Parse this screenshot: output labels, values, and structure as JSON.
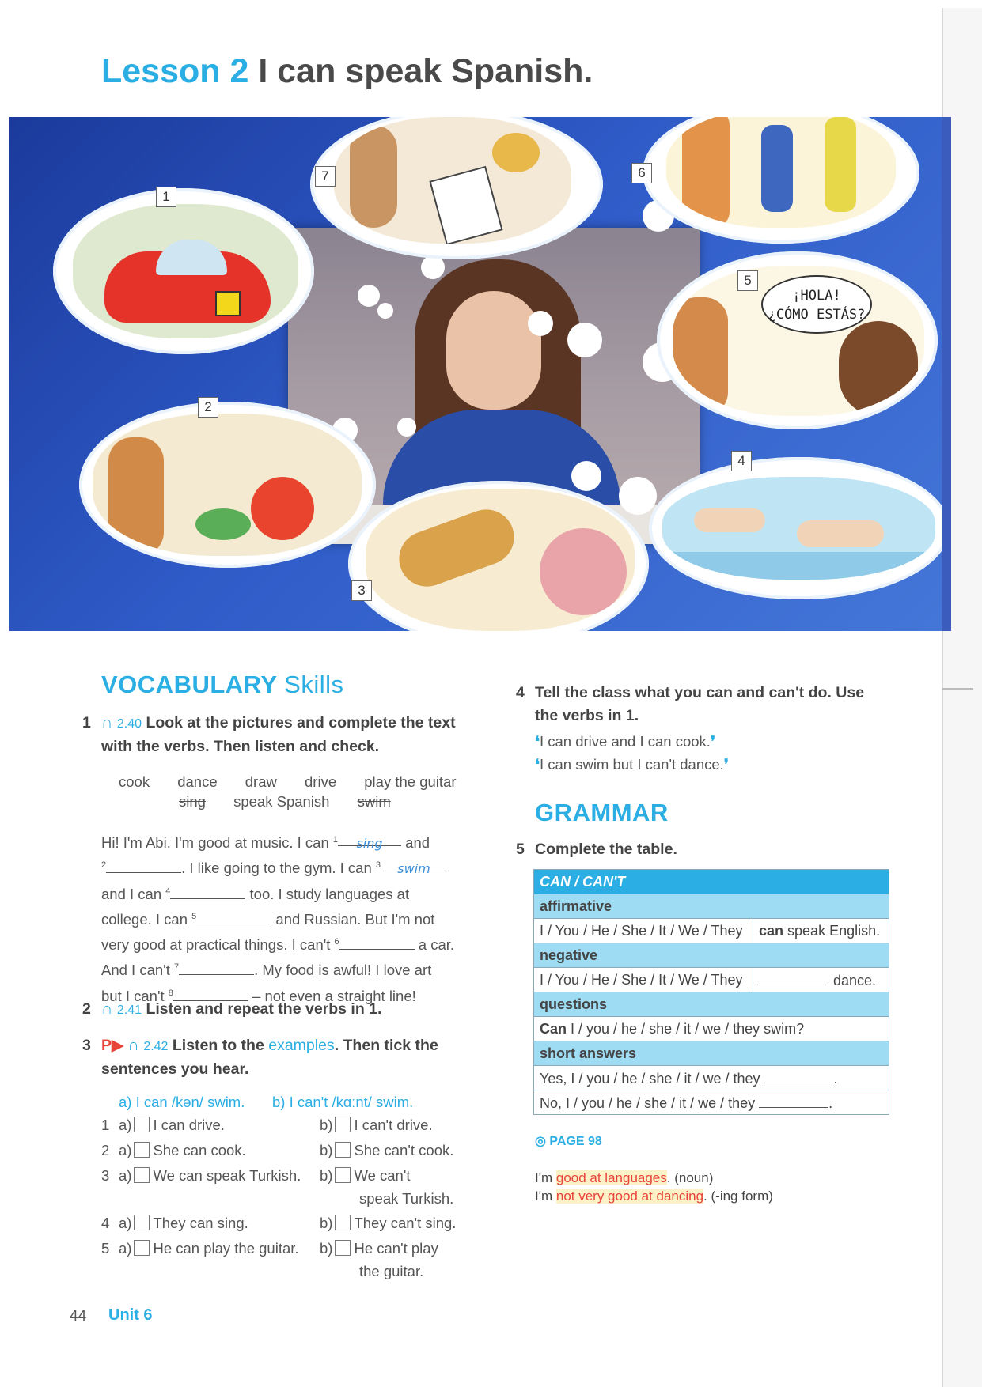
{
  "header": {
    "lesson_number": "Lesson 2",
    "lesson_title": "I can speak Spanish."
  },
  "illustration": {
    "picture_numbers": [
      "1",
      "2",
      "3",
      "4",
      "5",
      "6",
      "7"
    ],
    "speech_bubble_line1": "¡HOLA!",
    "speech_bubble_line2": "¿CÓMO ESTÁS?"
  },
  "vocabulary": {
    "heading_main": "VOCABULARY",
    "heading_sub": "Skills",
    "task1": {
      "number": "1",
      "track": "2.40",
      "instruction": "Look at the pictures and complete the text with the verbs. Then listen and check."
    },
    "word_box": {
      "row1": [
        "cook",
        "dance",
        "draw",
        "drive",
        "play the guitar"
      ],
      "row2": [
        "sing",
        "speak Spanish",
        "swim"
      ]
    },
    "text": {
      "l1a": "Hi! I'm Abi. I'm good at music. I can ",
      "n1": "1",
      "a1": "sing",
      "l1b": " and",
      "n2": "2",
      "l2a": ". I like going to the gym. I can ",
      "n3": "3",
      "a3": "swim",
      "l3a": "and I can ",
      "n4": "4",
      "l3b": " too. I study languages at",
      "l4a": "college. I can ",
      "n5": "5",
      "l4b": " and Russian. But I'm not",
      "l5a": "very good at practical things. I can't ",
      "n6": "6",
      "l5b": " a car.",
      "l6a": "And I can't ",
      "n7": "7",
      "l6b": ". My food is awful! I love art",
      "l7a": "but I can't ",
      "n8": "8",
      "l7b": " – not even a straight line!"
    },
    "task2": {
      "number": "2",
      "track": "2.41",
      "instruction": "Listen and repeat the verbs in 1."
    },
    "task3": {
      "number": "3",
      "track": "2.42",
      "instruction_a": "Listen to the ",
      "instruction_link": "examples",
      "instruction_b": ". Then tick the sentences you hear.",
      "examples": {
        "a": "a) I can /kən/ swim.",
        "b": "b)  I can't /kɑːnt/ swim."
      },
      "items": [
        {
          "n": "1",
          "a_label": "a)",
          "a": "I can drive.",
          "b_label": "b)",
          "b": "I can't drive.",
          "b2": ""
        },
        {
          "n": "2",
          "a_label": "a)",
          "a": "She can cook.",
          "b_label": "b)",
          "b": "She can't cook.",
          "b2": ""
        },
        {
          "n": "3",
          "a_label": "a)",
          "a": "We can speak Turkish.",
          "b_label": "b)",
          "b": "We can't",
          "b2": "speak Turkish."
        },
        {
          "n": "4",
          "a_label": "a)",
          "a": "They can sing.",
          "b_label": "b)",
          "b": "They can't sing.",
          "b2": ""
        },
        {
          "n": "5",
          "a_label": "a)",
          "a": "He can play the guitar.",
          "b_label": "b)",
          "b": "He can't play",
          "b2": "the guitar."
        }
      ]
    }
  },
  "task4": {
    "number": "4",
    "instruction": "Tell the class what you can and can't do. Use the verbs in 1.",
    "example1": "I can drive and I can cook.",
    "example2": "I can swim but I can't dance."
  },
  "grammar": {
    "heading": "GRAMMAR",
    "task5": {
      "number": "5",
      "instruction": "Complete the table."
    },
    "table": {
      "title": "CAN / CAN'T",
      "affirmative": "affirmative",
      "aff_subject": "I / You / He / She / It / We / They",
      "aff_verb_bold": "can",
      "aff_verb_rest": " speak English.",
      "negative": "negative",
      "neg_subject": "I / You / He / She / It / We / They",
      "neg_end": "dance.",
      "questions": "questions",
      "q_bold": "Can",
      "q_rest": " I / you / he / she / it / we / they swim?",
      "short_answers": "short answers",
      "yes": "Yes, I / you / he / she / it / we / they",
      "no": "No, I / you / he / she / it / we / they"
    },
    "page_ref": "PAGE 98",
    "note1": {
      "pre": "I'm ",
      "hl": "good at languages",
      "post": ". (noun)"
    },
    "note2": {
      "pre": "I'm ",
      "hl": "not very good at dancing",
      "post": ". (-ing form)"
    }
  },
  "footer": {
    "page_number": "44",
    "unit": "Unit 6"
  }
}
